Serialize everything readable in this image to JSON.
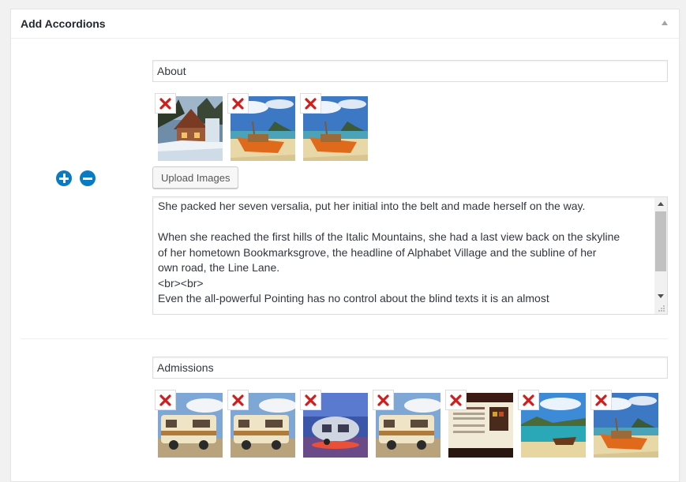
{
  "postbox": {
    "title": "Add Accordions"
  },
  "accordions": [
    {
      "title_value": "About",
      "images": [
        "snowy-cottage",
        "longtail-boat-beach",
        "longtail-boat-beach"
      ],
      "upload_label": "Upload Images",
      "description_lines": [
        "She packed her seven versalia, put her initial into the belt and made herself on the way.",
        "",
        "When she reached the first hills of the Italic Mountains, she had a last view back on the skyline",
        "of her hometown Bookmarksgrove, the headline of Alphabet Village and the subline of her",
        "own road, the Line Lane.",
        "<br><br>",
        "Even the all-powerful Pointing has no control about the blind texts it is an almost"
      ]
    },
    {
      "title_value": "Admissions",
      "images": [
        "rv-trailer",
        "rv-trailer",
        "airstream-sunset",
        "rv-trailer",
        "website-screenshot",
        "boat-cove",
        "longtail-boat-beach"
      ]
    }
  ],
  "icons": {
    "add": "plus-circle-icon",
    "remove": "minus-circle-icon",
    "delete": "red-x-icon",
    "collapse": "triangle-up-icon"
  },
  "colors": {
    "accent_blue": "#0a7ac2",
    "delete_red": "#cc1f1f",
    "panel_bg": "#ffffff",
    "page_bg": "#f1f1f1"
  }
}
